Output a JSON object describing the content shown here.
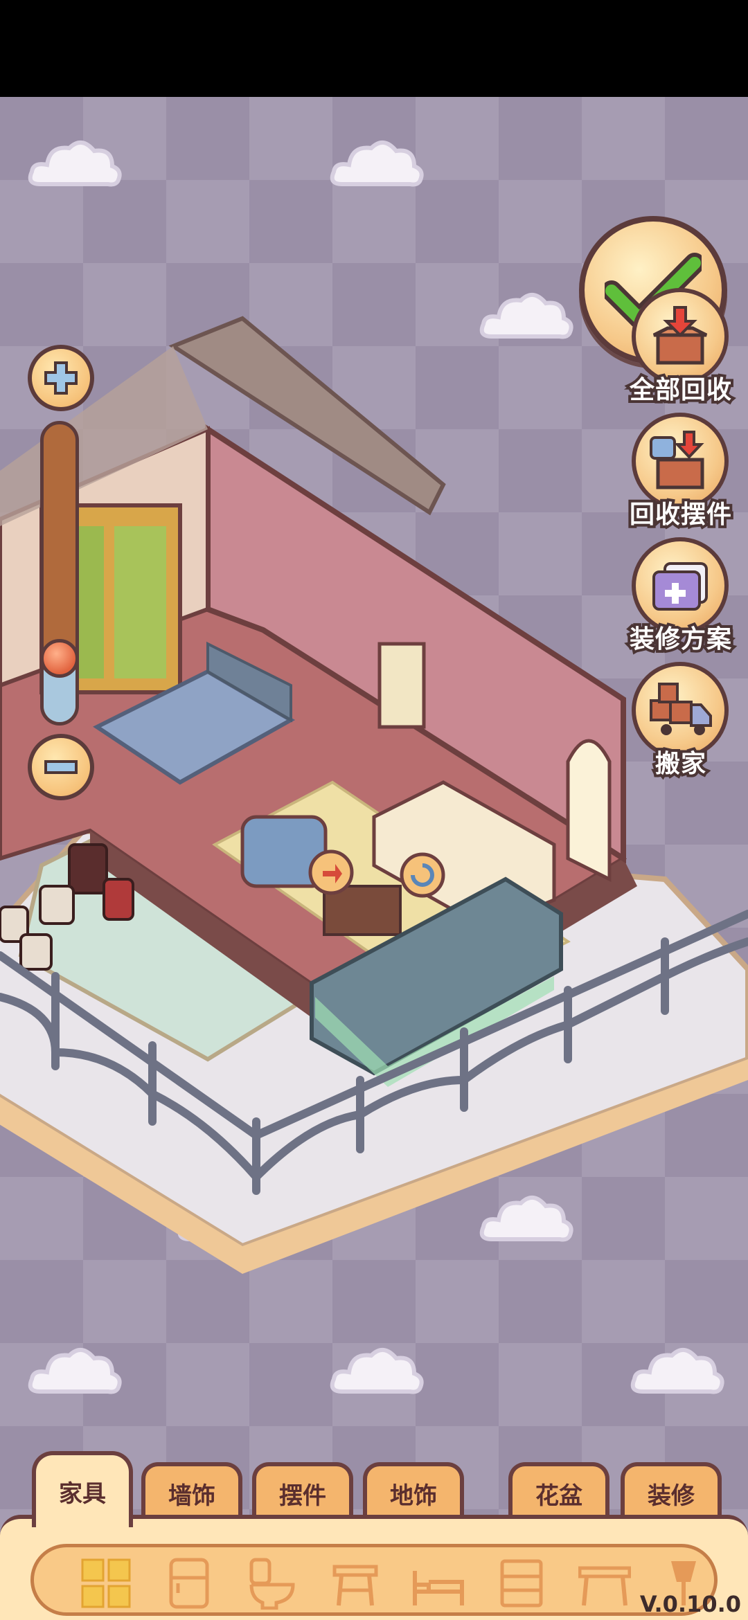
{
  "side_buttons": [
    {
      "id": "recycle-all",
      "label": "全部回收",
      "icon": "box-arrow-in-icon"
    },
    {
      "id": "recycle-items",
      "label": "回收摆件",
      "icon": "cup-box-icon"
    },
    {
      "id": "renovation-plan",
      "label": "装修方案",
      "icon": "card-plus-icon"
    },
    {
      "id": "move-house",
      "label": "搬家",
      "icon": "moving-truck-icon"
    }
  ],
  "confirm": {
    "icon": "checkmark-icon"
  },
  "zoom": {
    "level": 0.22
  },
  "tabs": [
    {
      "label": "家具",
      "active": true
    },
    {
      "label": "墙饰",
      "active": false
    },
    {
      "label": "摆件",
      "active": false
    },
    {
      "label": "地饰",
      "active": false
    },
    {
      "label": "花盆",
      "active": false
    },
    {
      "label": "装修",
      "active": false
    }
  ],
  "categories": [
    "all-grid-icon",
    "fridge-icon",
    "toilet-icon",
    "stool-icon",
    "bed-icon",
    "cabinet-icon",
    "table-icon",
    "lamp-icon"
  ],
  "version": "V.0.10.0",
  "colors": {
    "accent": "#f6c27a",
    "outline": "#5c3b3b",
    "check": "#5fbf3b"
  }
}
